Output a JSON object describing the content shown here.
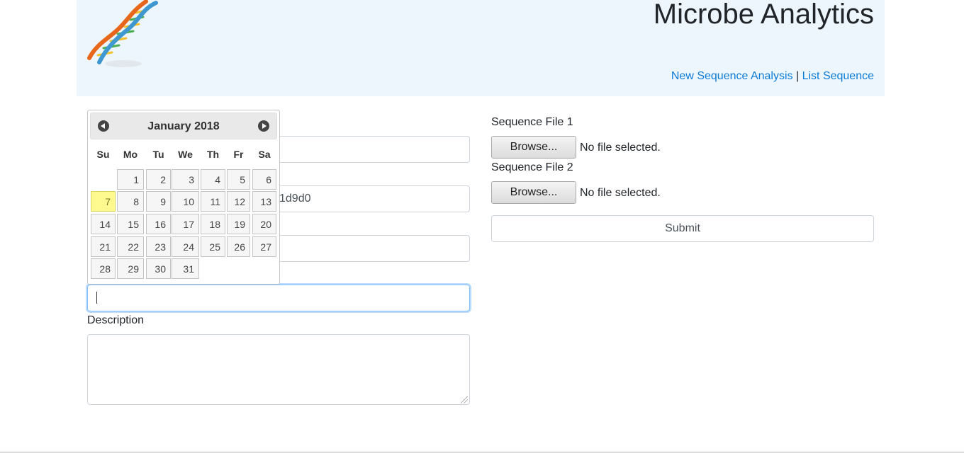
{
  "header": {
    "app_title": "Microbe Analytics",
    "nav": {
      "new_analysis": "New Sequence Analysis",
      "separator": "|",
      "list_sequence": "List Sequence"
    },
    "logo_icon": "dna-helix-icon"
  },
  "form": {
    "field2_value_partial": "1d9d0",
    "description_label": "Description",
    "file1_label": "Sequence File 1",
    "file2_label": "Sequence File 2",
    "browse_label": "Browse...",
    "file1_status": "No file selected.",
    "file2_status": "No file selected.",
    "submit_label": "Submit"
  },
  "datepicker": {
    "title": "January 2018",
    "prev_icon": "circle-triangle-left-icon",
    "next_icon": "circle-triangle-right-icon",
    "weekdays": [
      "Su",
      "Mo",
      "Tu",
      "We",
      "Th",
      "Fr",
      "Sa"
    ],
    "first_weekday_index": 1,
    "days_in_month": 31,
    "today": 7,
    "today_color": "#fffa90"
  }
}
